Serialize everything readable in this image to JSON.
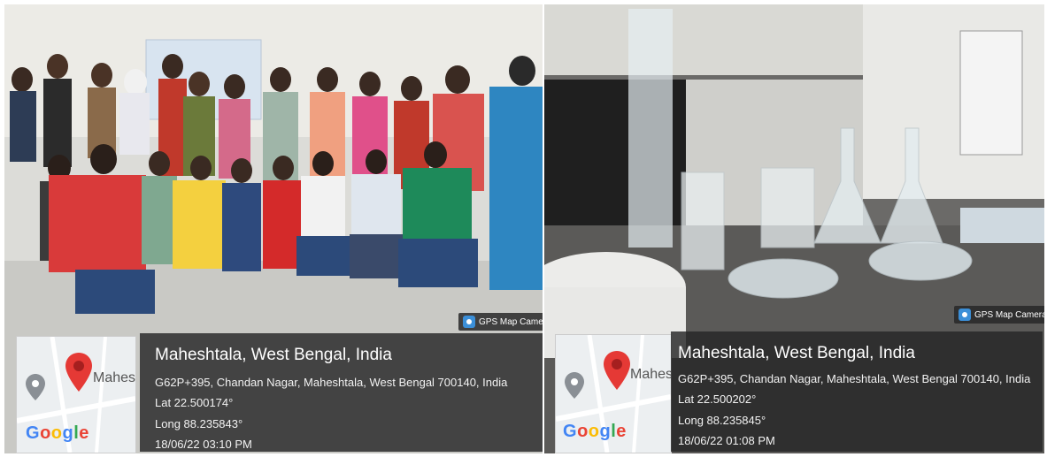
{
  "photos": [
    {
      "badge": "GPS Map Camera",
      "map_label": "Mahes",
      "google": [
        "G",
        "o",
        "o",
        "g",
        "l",
        "e"
      ],
      "location": "Maheshtala, West Bengal, India",
      "address": "G62P+395, Chandan Nagar, Maheshtala, West Bengal 700140, India",
      "lat": "Lat 22.500174°",
      "long": "Long 88.235843°",
      "datetime": "18/06/22 03:10 PM"
    },
    {
      "badge": "GPS Map Camera",
      "map_label": "Mahes",
      "google": [
        "G",
        "o",
        "o",
        "g",
        "l",
        "e"
      ],
      "location": "Maheshtala, West Bengal, India",
      "address": "G62P+395, Chandan Nagar, Maheshtala, West Bengal 700140, India",
      "lat": "Lat 22.500202°",
      "long": "Long 88.235845°",
      "datetime": "18/06/22 01:08 PM"
    }
  ],
  "colors": {
    "pin": "#e53935",
    "google_blue": "#4285F4",
    "google_red": "#EA4335",
    "google_yellow": "#FBBC05",
    "google_green": "#34A853",
    "overlay": "#262626"
  }
}
